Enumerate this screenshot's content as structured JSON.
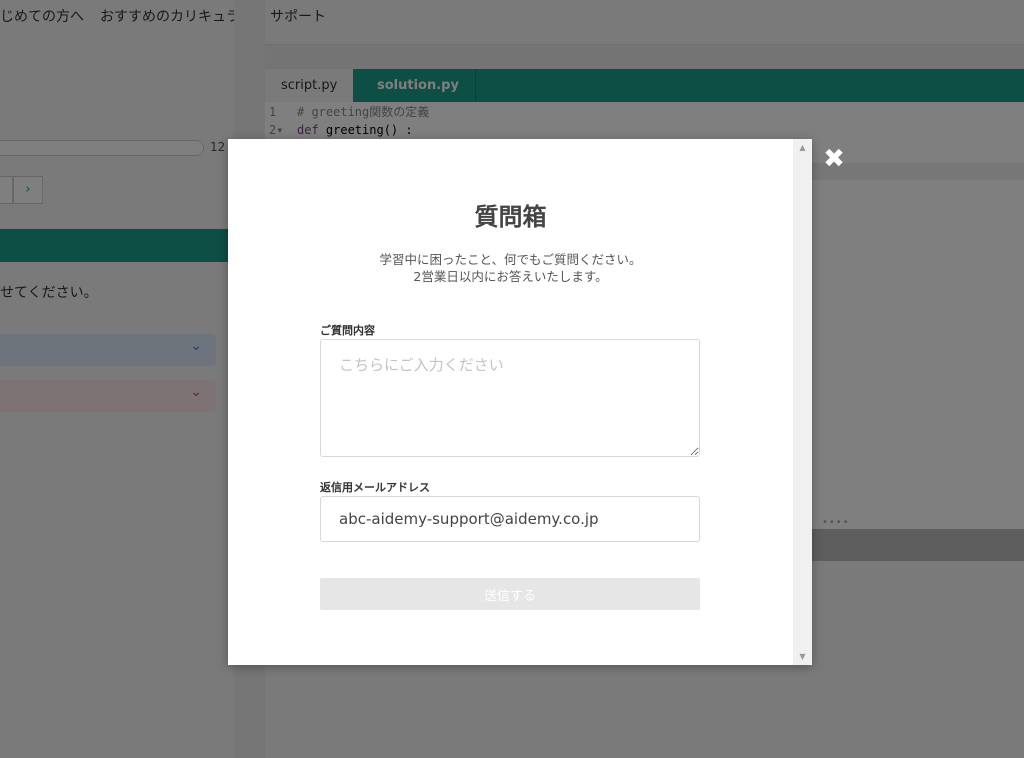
{
  "nav": {
    "items": [
      "じめての方へ",
      "おすすめのカリキュラム",
      "サポート"
    ]
  },
  "left": {
    "progress_count": "12",
    "pager_next": "›",
    "instruction": "せてください。"
  },
  "editor": {
    "tabs": [
      {
        "label": "script.py",
        "active": true
      },
      {
        "label": "solution.py",
        "active": false
      }
    ],
    "code": [
      {
        "num": "1",
        "text": "#  greeting関数の定義"
      },
      {
        "num": "2▾",
        "kw": "def",
        "rest": " greeting() :"
      }
    ],
    "resize_dots": "••••"
  },
  "modal": {
    "close": "✖",
    "title": "質問箱",
    "desc_line1": "学習中に困ったこと、何でもご質問ください。",
    "desc_line2": "2営業日以内にお答えいたします。",
    "question_label": "ご質問内容",
    "question_placeholder": "こちらにご入力ください",
    "email_label": "返信用メールアドレス",
    "email_value": "abc-aidemy-support@aidemy.co.jp",
    "submit_label": "送信する",
    "scroll_up": "▲",
    "scroll_down": "▼"
  },
  "colors": {
    "accent": "#1a9c8a",
    "overlay": "rgba(0,0,0,0.5)"
  }
}
